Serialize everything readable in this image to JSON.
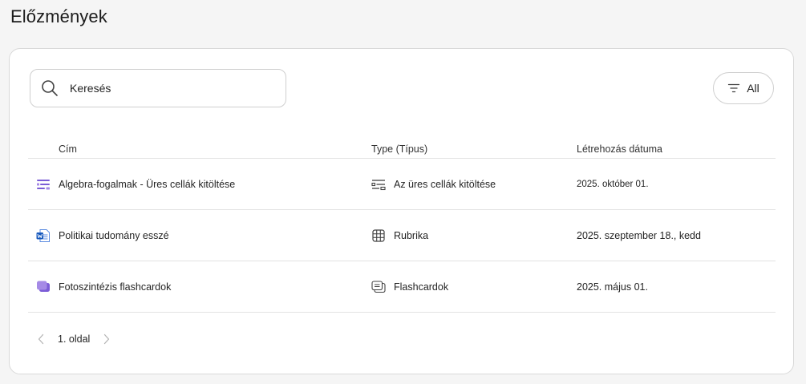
{
  "page": {
    "title": "Előzmények"
  },
  "search": {
    "placeholder": "Keresés"
  },
  "filter": {
    "label": "All"
  },
  "table": {
    "headers": {
      "title": "Cím",
      "type": "Type (Típus)",
      "date": "Létrehozás dátuma"
    },
    "rows": [
      {
        "title": "Algebra-fogalmak - Üres cellák kitöltése",
        "title_icon": "fill-blanks-icon",
        "type": "Az üres cellák kitöltése",
        "type_icon": "fill-blanks-outline-icon",
        "date": "2025. október 01."
      },
      {
        "title": "Politikai tudomány esszé",
        "title_icon": "word-document-icon",
        "type": "Rubrika",
        "type_icon": "grid-table-icon",
        "date": "2025. szeptember 18., kedd"
      },
      {
        "title": "Fotoszintézis flashcardok",
        "title_icon": "flashcards-icon",
        "type": "Flashcardok",
        "type_icon": "flashcards-outline-icon",
        "date": "2025. május 01."
      }
    ]
  },
  "pagination": {
    "label": "1. oldal"
  },
  "colors": {
    "accent": "#7b5cd6",
    "word_blue": "#185abd",
    "border": "#d9d9d9"
  }
}
